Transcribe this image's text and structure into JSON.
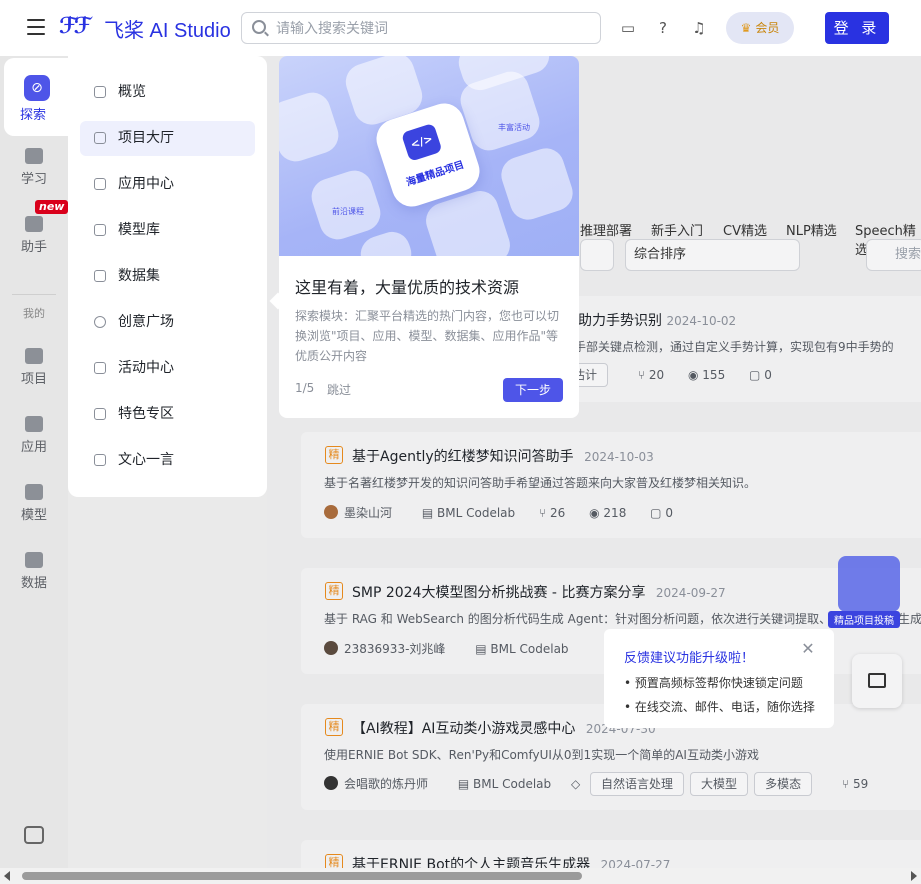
{
  "header": {
    "logo_mark": "ℱℱ",
    "logo_text": "飞桨 AI Studio",
    "search_placeholder": "请输入搜索关键词",
    "vip_label": "会员",
    "login_label": "登 录"
  },
  "rail": {
    "items": [
      {
        "label": "探索"
      },
      {
        "label": "学习"
      },
      {
        "label": "助手"
      },
      {
        "label": "项目"
      },
      {
        "label": "应用"
      },
      {
        "label": "模型"
      },
      {
        "label": "数据"
      }
    ],
    "new_badge": "new",
    "mine_label": "我的"
  },
  "submenu": {
    "items": [
      {
        "label": "概览"
      },
      {
        "label": "项目大厅"
      },
      {
        "label": "应用中心"
      },
      {
        "label": "模型库"
      },
      {
        "label": "数据集"
      },
      {
        "label": "创意广场"
      },
      {
        "label": "活动中心"
      },
      {
        "label": "特色专区"
      },
      {
        "label": "文心一言"
      }
    ]
  },
  "tour": {
    "art_labels": {
      "main": "海量精品项目",
      "left": "前沿课程",
      "right": "丰富活动"
    },
    "title": "这里有着，大量优质的技术资源",
    "text": "探索模块：汇聚平台精选的热门内容，您也可以切换浏览\"项目、应用、模型、数据集、应用作品\"等优质公开内容",
    "step": "1/5",
    "skip": "跳过",
    "next": "下一步"
  },
  "content": {
    "tabs": [
      "推理部署",
      "新手入门",
      "CV精选",
      "NLP精选",
      "Speech精选"
    ],
    "sort_value": "综合排序",
    "search_placeholder": "搜索",
    "cards": [
      {
        "title": "检测助力手势识别",
        "date": "2024-10-02",
        "desc": "进行手部关键点检测，通过自定义手势计算，实现包有9中手势的",
        "chip": "态估计",
        "forks": "20",
        "views": "155",
        "comments": "0"
      },
      {
        "tag": "精",
        "title": "基于Agently的红楼梦知识问答助手",
        "date": "2024-10-03",
        "desc": "基于名著红楼梦开发的知识问答助手希望通过答题来向大家普及红楼梦相关知识。",
        "author": "墨染山河",
        "platform": "BML Codelab",
        "forks": "26",
        "views": "218",
        "comments": "0"
      },
      {
        "tag": "精",
        "title": "SMP 2024大模型图分析挑战赛 - 比赛方案分享",
        "date": "2024-09-27",
        "desc": "基于 RAG 和 WebSearch 的图分析代码生成 Agent：针对图分析问题，依次进行关键词提取、RA",
        "desc_tail": "生成",
        "author": "23836933-刘兆峰",
        "platform": "BML Codelab"
      },
      {
        "tag": "精",
        "title": "【AI教程】AI互动类小游戏灵感中心",
        "date": "2024-07-30",
        "desc": "使用ERNIE Bot SDK、Ren'Py和ComfyUI从0到1实现一个简单的AI互动类小游戏",
        "author": "会唱歌的炼丹师",
        "platform": "BML Codelab",
        "chips": [
          "自然语言处理",
          "大模型",
          "多模态"
        ],
        "forks": "59"
      },
      {
        "tag": "精",
        "title": "基于ERNIE Bot的个人主题音乐生成器",
        "date": "2024-07-27"
      }
    ]
  },
  "feedback": {
    "title": "反馈建议功能升级啦！",
    "items": [
      "• 预置高频标签帮你快速锁定问题",
      "• 在线交流、邮件、电话，随你选择"
    ],
    "close": "✕"
  },
  "promo_label": "精品项目投稿",
  "colors": {
    "brand": "#2932e1",
    "accent": "#4e55e8",
    "tag": "#e5891d"
  }
}
